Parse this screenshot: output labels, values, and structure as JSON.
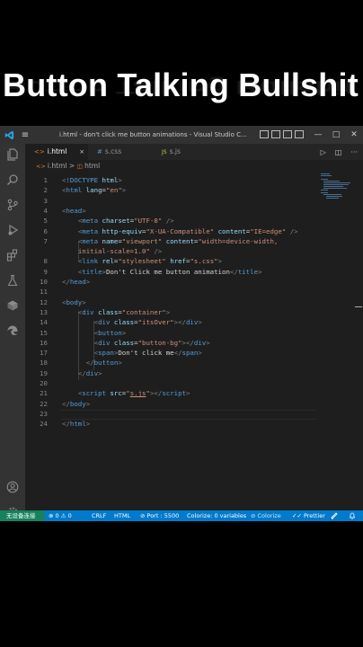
{
  "caption": {
    "text": "Button Talking Bullshit"
  },
  "titlebar": {
    "title": "i.html - don't click me button animations - Visual Studio C...",
    "menu_icon": "hamburger-icon",
    "controls": [
      "—",
      "□",
      "✕"
    ]
  },
  "tabs": [
    {
      "label": "i.html",
      "icon": "html-file-icon",
      "active": true,
      "close": "×"
    },
    {
      "label": "s.css",
      "icon": "css-file-icon",
      "icon_glyph": "#",
      "active": false
    },
    {
      "label": "s.js",
      "icon": "js-file-icon",
      "icon_glyph": "JS",
      "active": false
    }
  ],
  "breadcrumb": {
    "file": "i.html",
    "separator": ">",
    "node": "html"
  },
  "editor": {
    "lines": [
      {
        "n": "1",
        "html": "<span class='p'>&lt;</span><span class='t'>!DOCTYPE</span> <span class='a'>html</span><span class='p'>&gt;</span>"
      },
      {
        "n": "2",
        "html": "<span class='p'>&lt;</span><span class='t'>html</span> <span class='a'>lang</span><span class='d'>=</span><span class='s'>\"en\"</span><span class='p'>&gt;</span>"
      },
      {
        "n": "3",
        "html": ""
      },
      {
        "n": "4",
        "html": "<span class='p'>&lt;</span><span class='t'>head</span><span class='p'>&gt;</span>"
      },
      {
        "n": "5",
        "html": "    <span class='p'>&lt;</span><span class='t'>meta</span> <span class='a'>charset</span><span class='d'>=</span><span class='s'>\"UTF-8\"</span> <span class='p'>/&gt;</span>"
      },
      {
        "n": "6",
        "html": "    <span class='p'>&lt;</span><span class='t'>meta</span> <span class='a'>http-equiv</span><span class='d'>=</span><span class='s'>\"X-UA-Compatible\"</span> <span class='a'>content</span><span class='d'>=</span><span class='s'>\"IE=edge\"</span> <span class='p'>/&gt;</span>"
      },
      {
        "n": "7",
        "html": "    <span class='p'>&lt;</span><span class='t'>meta</span> <span class='a'>name</span><span class='d'>=</span><span class='s'>\"viewport\"</span> <span class='a'>content</span><span class='d'>=</span><span class='s'>\"width=device-width,</span>"
      },
      {
        "n": "",
        "html": "    <span class='s'>initial-scale=1.0\"</span> <span class='p'>/&gt;</span>"
      },
      {
        "n": "8",
        "html": "    <span class='p'>&lt;</span><span class='t'>link</span> <span class='a'>rel</span><span class='d'>=</span><span class='s'>\"stylesheet\"</span> <span class='a'>href</span><span class='d'>=</span><span class='s'>\"s.css\"</span><span class='p'>&gt;</span>"
      },
      {
        "n": "9",
        "html": "    <span class='p'>&lt;</span><span class='t'>title</span><span class='p'>&gt;</span><span class='d'>Don't Click me button animation</span><span class='p'>&lt;/</span><span class='t'>title</span><span class='p'>&gt;</span>"
      },
      {
        "n": "10",
        "html": "<span class='p'>&lt;/</span><span class='t'>head</span><span class='p'>&gt;</span>"
      },
      {
        "n": "11",
        "html": ""
      },
      {
        "n": "12",
        "html": "<span class='p'>&lt;</span><span class='t'>body</span><span class='p'>&gt;</span>"
      },
      {
        "n": "13",
        "html": "    <span class='p'>&lt;</span><span class='t'>div</span> <span class='a'>class</span><span class='d'>=</span><span class='s'>\"container\"</span><span class='p'>&gt;</span>"
      },
      {
        "n": "14",
        "html": "        <span class='p'>&lt;</span><span class='t'>div</span> <span class='a'>class</span><span class='d'>=</span><span class='s'>\"itsOver\"</span><span class='p'>&gt;&lt;/</span><span class='t'>div</span><span class='p'>&gt;</span>"
      },
      {
        "n": "15",
        "html": "        <span class='p'>&lt;</span><span class='t'>button</span><span class='p'>&gt;</span>"
      },
      {
        "n": "16",
        "html": "        <span class='p'>&lt;</span><span class='t'>div</span> <span class='a'>class</span><span class='d'>=</span><span class='s'>\"button-bg\"</span><span class='p'>&gt;&lt;/</span><span class='t'>div</span><span class='p'>&gt;</span>"
      },
      {
        "n": "17",
        "html": "        <span class='p'>&lt;</span><span class='t'>span</span><span class='p'>&gt;</span><span class='d'>Don't click me</span><span class='p'>&lt;/</span><span class='t'>span</span><span class='p'>&gt;</span>"
      },
      {
        "n": "18",
        "html": "      <span class='p'>&lt;/</span><span class='t'>button</span><span class='p'>&gt;</span>"
      },
      {
        "n": "19",
        "html": "    <span class='p'>&lt;/</span><span class='t'>div</span><span class='p'>&gt;</span>"
      },
      {
        "n": "20",
        "html": ""
      },
      {
        "n": "21",
        "html": "    <span class='p'>&lt;</span><span class='t'>script</span> <span class='a'>src</span><span class='d'>=</span><span class='s'>\"<u>s.js</u>\"</span><span class='p'>&gt;&lt;/</span><span class='t'>script</span><span class='p'>&gt;</span>"
      },
      {
        "n": "22",
        "html": "<span class='p'>&lt;/</span><span class='t'>body</span><span class='p'>&gt;</span>"
      },
      {
        "n": "23",
        "html": ""
      },
      {
        "n": "24",
        "html": "<span class='p'>&lt;/</span><span class='t'>html</span><span class='p'>&gt;</span>"
      }
    ]
  },
  "statusbar": {
    "remote": "无设备连接",
    "problems": "⊗ 0 ⚠ 0",
    "eol": "CRLF",
    "language": "HTML",
    "port": "⊘ Port : 5500",
    "colorize_vars": "Colorize: 0 variables",
    "colorize": "⊘ Colorize",
    "prettier": "✓✓ Prettier",
    "feedback_icon": "feedback-icon",
    "bell_icon": "bell-icon"
  },
  "colors": {
    "statusbar": "#007acc",
    "editor_bg": "#1e1e1e",
    "activity_bg": "#333333",
    "tag": "#569cd6",
    "attr": "#9cdcfe",
    "string": "#ce9178"
  },
  "activity_icons": [
    "files-icon",
    "search-icon",
    "source-control-icon",
    "run-debug-icon",
    "extensions-icon",
    "testing-icon",
    "remote-explorer-icon",
    "edge-devtools-icon",
    "account-icon",
    "settings-gear-icon"
  ]
}
